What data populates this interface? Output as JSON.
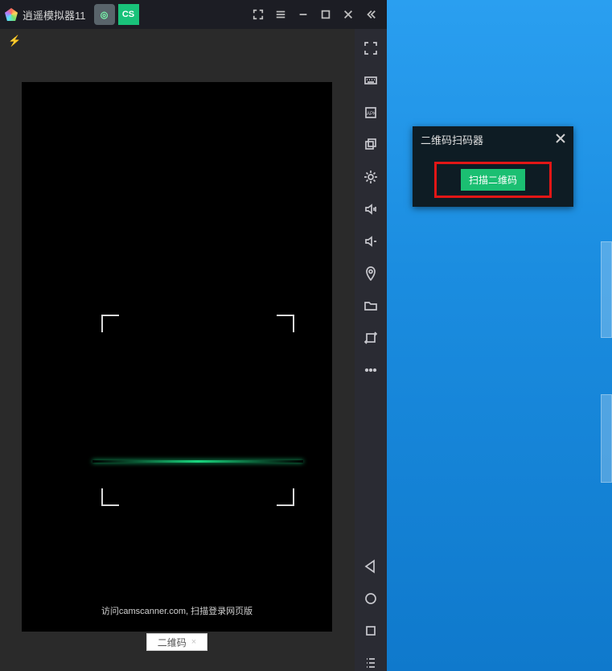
{
  "emulator": {
    "title": "逍遥模拟器11",
    "tabs": {
      "app1": "◎",
      "app2": "CS"
    },
    "screen": {
      "hint": "访问camscanner.com, 扫描登录网页版",
      "tag_label": "二维码",
      "tag_close": "×"
    }
  },
  "popup": {
    "title": "二维码扫码器",
    "scan_button": "扫描二维码"
  },
  "icons": {
    "bolt": "⚡"
  }
}
